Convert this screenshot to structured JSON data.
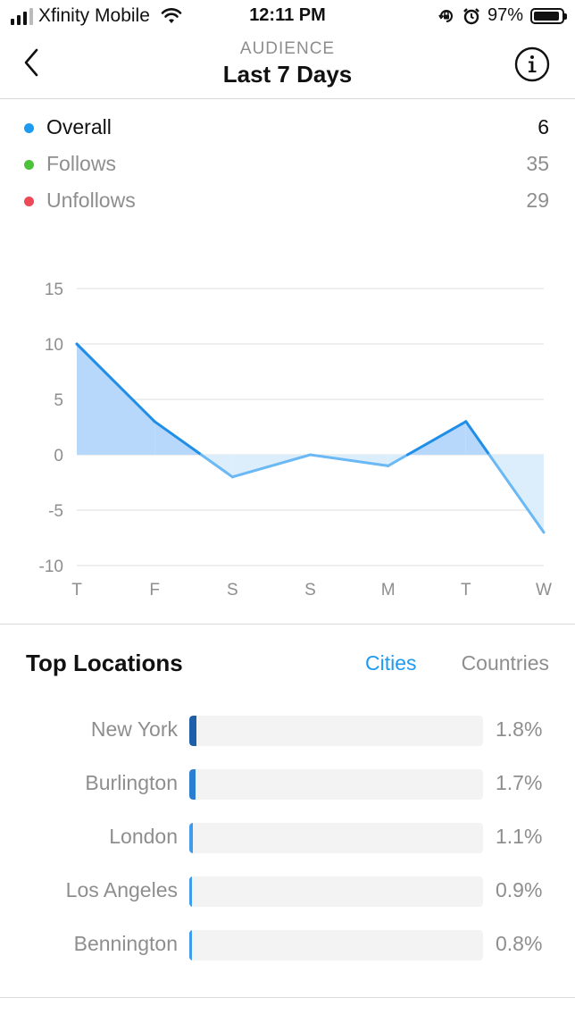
{
  "status_bar": {
    "carrier": "Xfinity Mobile",
    "time": "12:11 PM",
    "battery_pct": "97%"
  },
  "nav": {
    "subtitle": "AUDIENCE",
    "title": "Last 7 Days"
  },
  "legend": [
    {
      "label": "Overall",
      "value": "6",
      "color": "#1d9bf0",
      "text_color": "#111111"
    },
    {
      "label": "Follows",
      "value": "35",
      "color": "#4cc13a",
      "text_color": "#8e8e8e"
    },
    {
      "label": "Unfollows",
      "value": "29",
      "color": "#ed4956",
      "text_color": "#8e8e8e"
    }
  ],
  "chart_data": {
    "type": "area",
    "categories": [
      "T",
      "F",
      "S",
      "S",
      "M",
      "T",
      "W"
    ],
    "series": [
      {
        "name": "Overall",
        "values": [
          10,
          3,
          -2,
          0,
          -1,
          3,
          -7
        ]
      }
    ],
    "yticks": [
      15,
      10,
      5,
      0,
      -5,
      -10
    ],
    "ylim": [
      -10,
      15
    ],
    "grid": true,
    "colors": {
      "line_pos": "#1f8ee8",
      "line_neg": "#6ab8f4",
      "fill_pos": "#b7d8fb",
      "fill_neg": "#dceefc"
    }
  },
  "top_locations": {
    "title": "Top Locations",
    "tab_cities": "Cities",
    "tab_countries": "Countries",
    "items": [
      {
        "name": "New York",
        "pct": "1.8%",
        "value": 1.8
      },
      {
        "name": "Burlington",
        "pct": "1.7%",
        "value": 1.7
      },
      {
        "name": "London",
        "pct": "1.1%",
        "value": 1.1
      },
      {
        "name": "Los Angeles",
        "pct": "0.9%",
        "value": 0.9
      },
      {
        "name": "Bennington",
        "pct": "0.8%",
        "value": 0.8
      }
    ]
  }
}
